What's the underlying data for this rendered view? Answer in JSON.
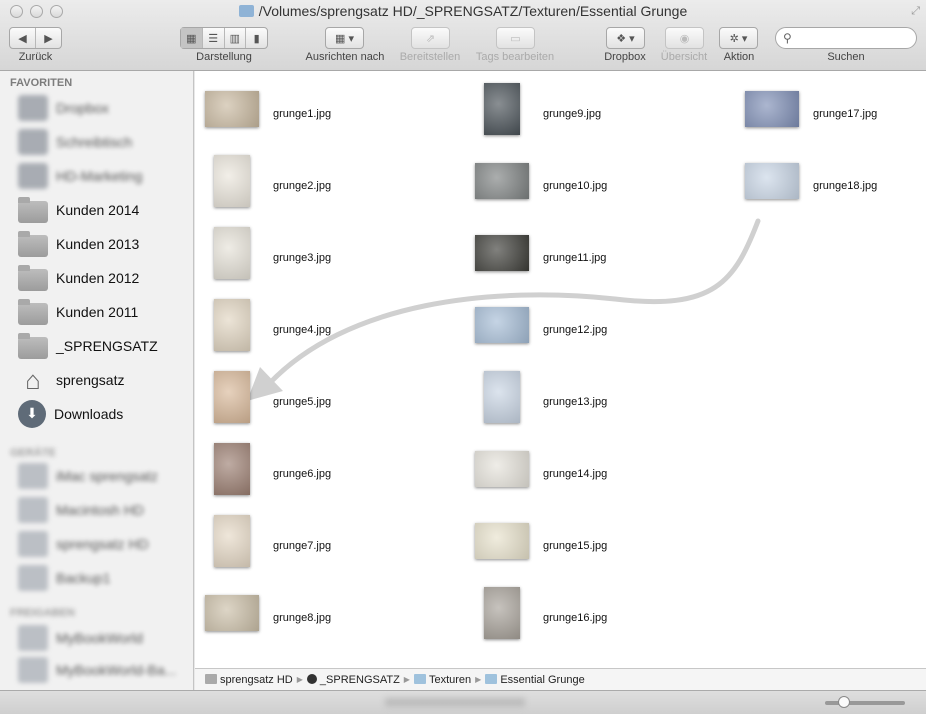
{
  "window": {
    "title": "/Volumes/sprengsatz HD/_SPRENGSATZ/Texturen/Essential Grunge"
  },
  "toolbar": {
    "back": "Zurück",
    "view": "Darstellung",
    "arrange": "Ausrichten nach",
    "share": "Bereitstellen",
    "tags": "Tags bearbeiten",
    "dropbox": "Dropbox",
    "quicklook": "Übersicht",
    "action": "Aktion",
    "search": "Suchen",
    "search_value": ""
  },
  "sidebar": {
    "favorites_header": "FAVORITEN",
    "favorites": [
      {
        "label": "Dropbox",
        "blurred": true
      },
      {
        "label": "Schreibtisch",
        "blurred": true
      },
      {
        "label": "HD-Marketing",
        "blurred": true
      },
      {
        "label": "Kunden 2014",
        "icon": "folder-icon"
      },
      {
        "label": "Kunden 2013",
        "icon": "folder-icon"
      },
      {
        "label": "Kunden 2012",
        "icon": "folder-icon"
      },
      {
        "label": "Kunden 2011",
        "icon": "folder-icon"
      },
      {
        "label": "_SPRENGSATZ",
        "icon": "folder-icon"
      },
      {
        "label": "sprengsatz",
        "icon": "home-icon"
      },
      {
        "label": "Downloads",
        "icon": "downloads-icon"
      }
    ],
    "devices_header": "GERÄTE",
    "devices": [
      {
        "label": "iMac sprengsatz"
      },
      {
        "label": "Macintosh HD"
      },
      {
        "label": "sprengsatz HD"
      },
      {
        "label": "Backup1"
      }
    ],
    "shared_header": "FREIGABEN",
    "shared": [
      {
        "label": "MyBookWorld"
      },
      {
        "label": "MyBookWorld-Ba..."
      }
    ]
  },
  "files": [
    {
      "name": "grunge1.jpg",
      "orient": "landscape",
      "color": "#c9b9a0"
    },
    {
      "name": "grunge2.jpg",
      "orient": "portrait",
      "color": "#ebe6dc"
    },
    {
      "name": "grunge3.jpg",
      "orient": "portrait",
      "color": "#e6e2d8"
    },
    {
      "name": "grunge4.jpg",
      "orient": "portrait",
      "color": "#e2d6c2"
    },
    {
      "name": "grunge5.jpg",
      "orient": "portrait",
      "color": "#d9b99a"
    },
    {
      "name": "grunge6.jpg",
      "orient": "portrait",
      "color": "#9c7f72"
    },
    {
      "name": "grunge7.jpg",
      "orient": "portrait",
      "color": "#e6d9c6"
    },
    {
      "name": "grunge8.jpg",
      "orient": "landscape",
      "color": "#cbbfa8"
    },
    {
      "name": "grunge9.jpg",
      "orient": "portrait",
      "color": "#4a5258"
    },
    {
      "name": "grunge10.jpg",
      "orient": "landscape",
      "color": "#7e8282"
    },
    {
      "name": "grunge11.jpg",
      "orient": "landscape",
      "color": "#3d3d38"
    },
    {
      "name": "grunge12.jpg",
      "orient": "landscape",
      "color": "#a6bdd6"
    },
    {
      "name": "grunge13.jpg",
      "orient": "portrait",
      "color": "#c9d5e4"
    },
    {
      "name": "grunge14.jpg",
      "orient": "landscape",
      "color": "#e6e3db"
    },
    {
      "name": "grunge15.jpg",
      "orient": "landscape",
      "color": "#e8e2cc"
    },
    {
      "name": "grunge16.jpg",
      "orient": "portrait",
      "color": "#a8a29a"
    },
    {
      "name": "grunge17.jpg",
      "orient": "landscape",
      "color": "#7f8fb6"
    },
    {
      "name": "grunge18.jpg",
      "orient": "landscape",
      "color": "#c9d6e6"
    }
  ],
  "pathbar": [
    {
      "label": "sprengsatz HD",
      "icon": "drive-icon"
    },
    {
      "label": "_SPRENGSATZ",
      "icon": "folder-icon"
    },
    {
      "label": "Texturen",
      "icon": "folder-icon"
    },
    {
      "label": "Essential Grunge",
      "icon": "folder-icon"
    }
  ],
  "annotation": {
    "arrow_color": "#d0d0d0"
  }
}
